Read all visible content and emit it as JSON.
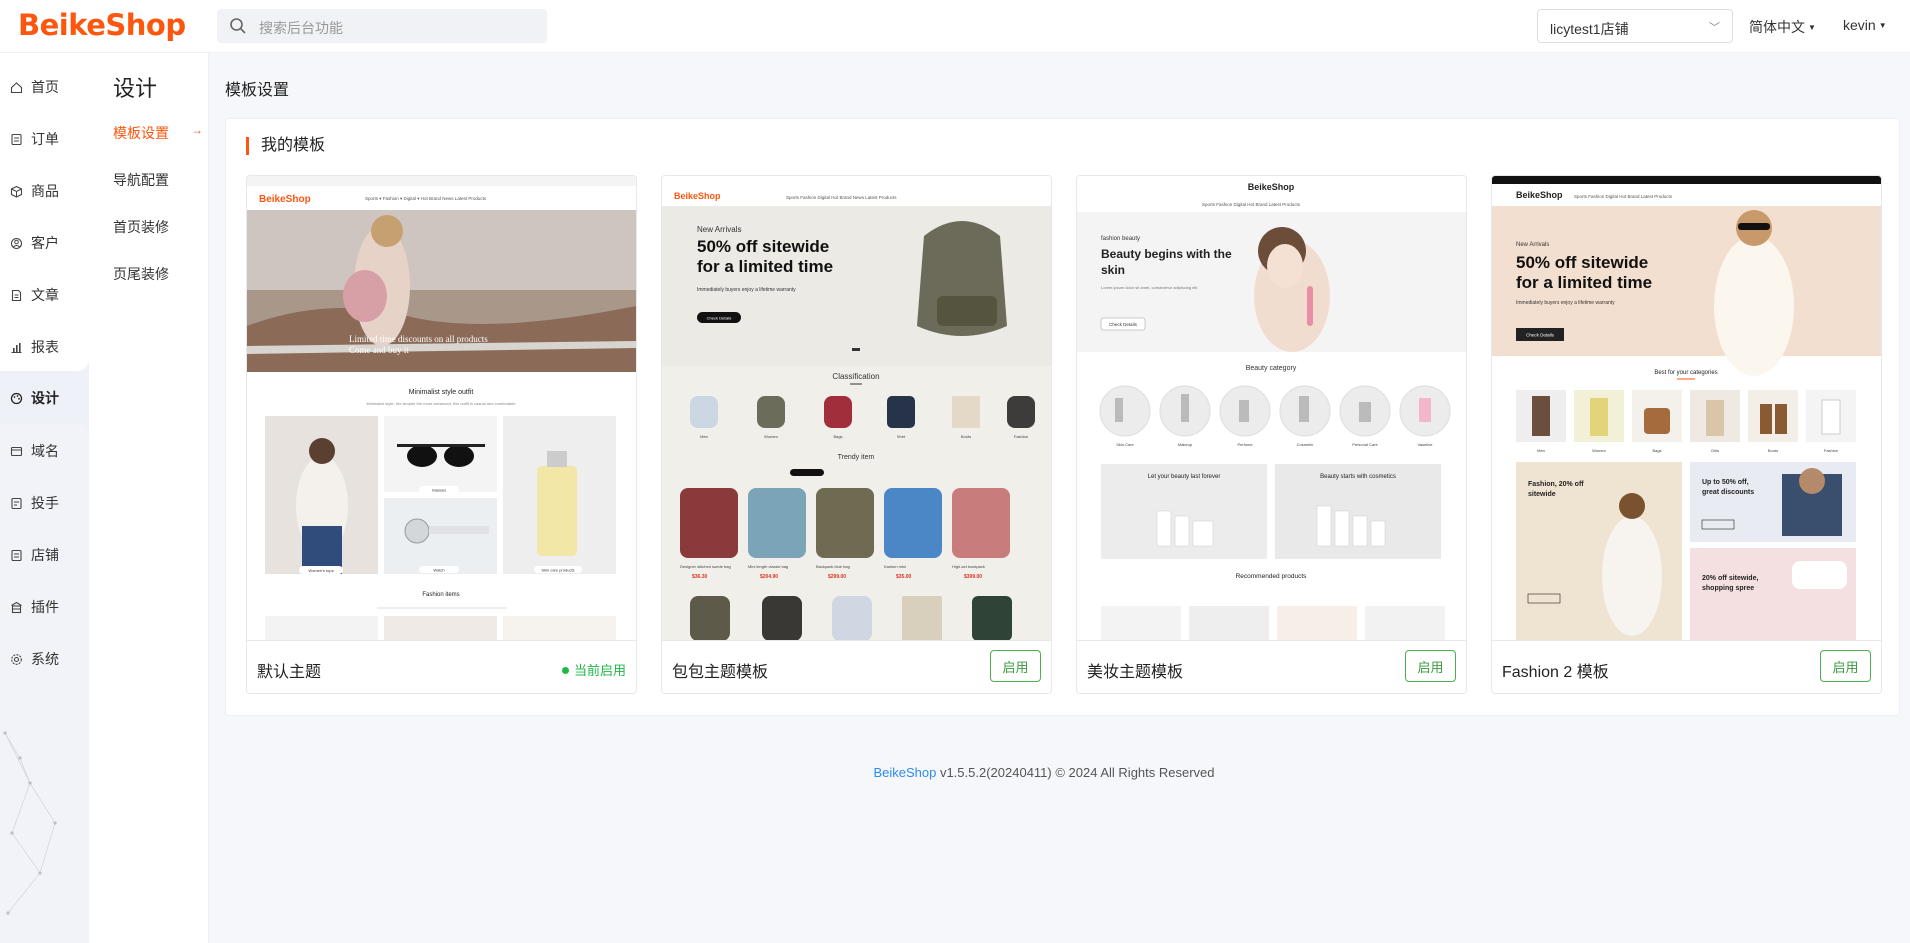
{
  "header": {
    "logo": "BeikeShop",
    "search_placeholder": "搜索后台功能",
    "store": "licytest1店铺",
    "language": "简体中文",
    "user": "kevin"
  },
  "nav": {
    "items": [
      {
        "label": "首页",
        "icon": "home-icon"
      },
      {
        "label": "订单",
        "icon": "order-icon"
      },
      {
        "label": "商品",
        "icon": "box-icon"
      },
      {
        "label": "客户",
        "icon": "user-icon"
      },
      {
        "label": "文章",
        "icon": "document-icon"
      },
      {
        "label": "报表",
        "icon": "chart-icon"
      },
      {
        "label": "设计",
        "icon": "palette-icon",
        "active": true
      },
      {
        "label": "域名",
        "icon": "domain-icon"
      },
      {
        "label": "投手",
        "icon": "target-icon"
      },
      {
        "label": "店铺",
        "icon": "store-icon"
      },
      {
        "label": "插件",
        "icon": "plugin-icon"
      },
      {
        "label": "系统",
        "icon": "gear-icon"
      }
    ]
  },
  "subnav": {
    "title": "设计",
    "items": [
      {
        "label": "模板设置",
        "active": true
      },
      {
        "label": "导航配置"
      },
      {
        "label": "首页装修"
      },
      {
        "label": "页尾装修"
      }
    ]
  },
  "main": {
    "breadcrumb": "模板设置",
    "section_title": "我的模板",
    "templates": [
      {
        "name": "默认主题",
        "status": "当前启用"
      },
      {
        "name": "包包主题模板",
        "action": "启用"
      },
      {
        "name": "美妆主题模板",
        "action": "启用"
      },
      {
        "name": "Fashion 2 模板",
        "action": "启用"
      }
    ]
  },
  "thumbs": {
    "t1": {
      "logo": "BeikeShop",
      "hero_line1": "Limited time discounts on all products",
      "hero_line2": "Come and buy it",
      "section": "Minimalist style outfit",
      "sub": "Minimalist style, the simpler the more advanced, this outfit is casual and comfortable",
      "label_a": "Women's tops",
      "label_b": "Glasses",
      "label_c": "Watch",
      "label_d": "Skin care products",
      "section2": "Fashion items"
    },
    "t2": {
      "logo": "BeikeShop",
      "tag": "New Arrivals",
      "headline1": "50% off sitewide",
      "headline2": "for a limited time",
      "sub": "Immediately buyers enjoy a lifetime warranty",
      "btn": "Check Details",
      "section": "Classification",
      "section2": "Trendy item",
      "cats": [
        "Men",
        "Women",
        "Bags",
        "Shirt",
        "Boots",
        "Fashion"
      ]
    },
    "t3": {
      "logo": "BeikeShop",
      "tag": "fashion beauty",
      "headline1": "Beauty begins with the",
      "headline2": "skin",
      "btn": "Check Details",
      "section": "Beauty category",
      "banner1": "Let your beauty last forever",
      "banner2": "Beauty starts with cosmetics",
      "section2": "Recommended products",
      "cats": [
        "Skin Care",
        "Makeup",
        "Perfume",
        "Cosmetic",
        "Personal Care",
        "Vaseline"
      ]
    },
    "t4": {
      "logo": "BeikeShop",
      "tag": "New Arrivals",
      "headline1": "50% off sitewide",
      "headline2": "for a limited time",
      "sub": "Immediately buyers enjoy a lifetime warranty",
      "btn": "Check Details",
      "section": "Best for your categories",
      "promo1a": "Fashion, 20% off",
      "promo1b": "sitewide",
      "promo2a": "Up to 50% off,",
      "promo2b": "great discounts",
      "promo3a": "20% off sitewide,",
      "promo3b": "shopping spree",
      "cats": [
        "Men",
        "Women",
        "Bags",
        "Girls",
        "Boots",
        "Fashion"
      ]
    }
  },
  "footer": {
    "brand": "BeikeShop",
    "text": " v1.5.5.2(20240411) © 2024 All Rights Reserved"
  },
  "colors": {
    "accent": "#fd560f",
    "success": "#1fb847",
    "link": "#2d8cf0"
  }
}
